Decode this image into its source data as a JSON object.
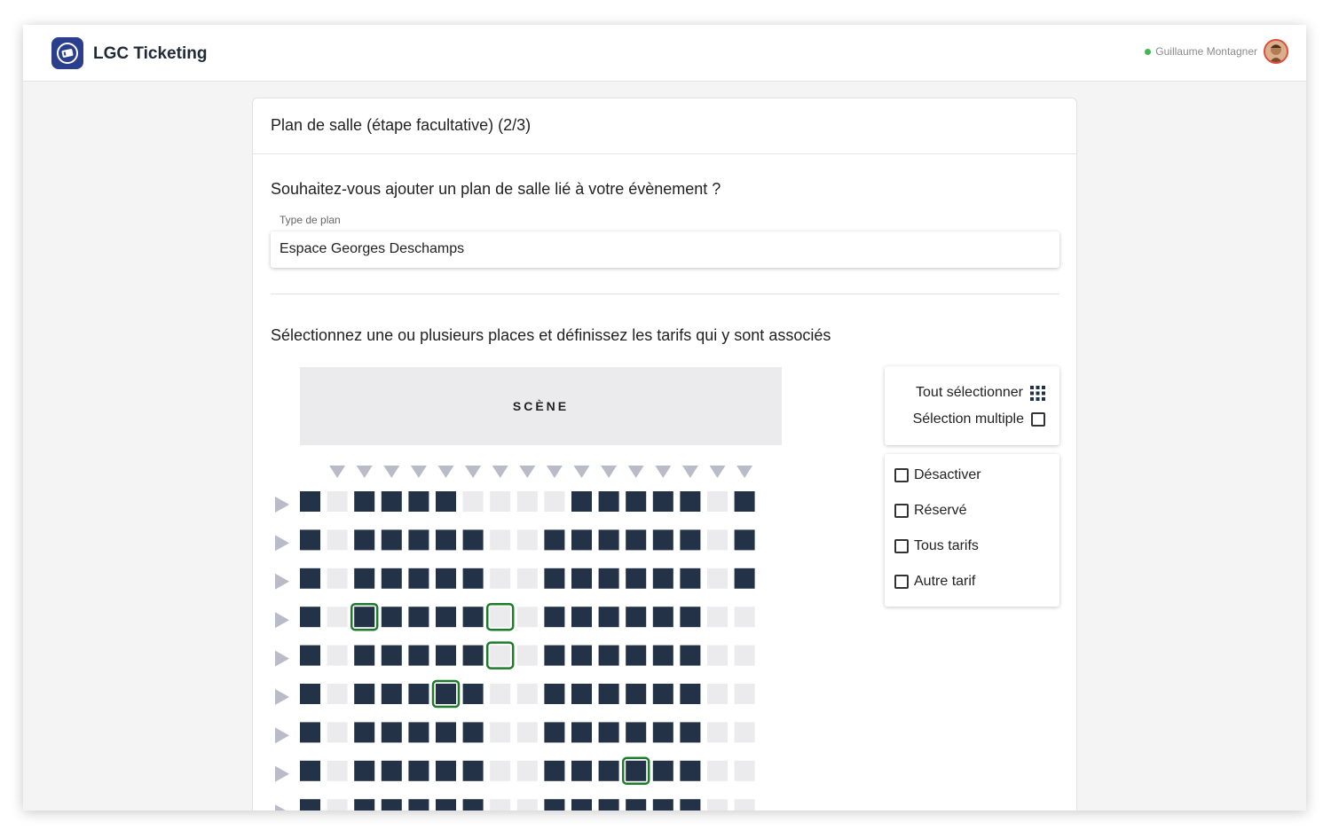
{
  "app": {
    "title": "LGC Ticketing"
  },
  "user": {
    "name": "Guillaume Montagner",
    "status_color": "#3fb950"
  },
  "card": {
    "title": "Plan de salle (étape facultative) (2/3)"
  },
  "question": "Souhaitez-vous ajouter un plan de salle lié à votre évènement ?",
  "plan_type": {
    "label": "Type de plan",
    "value": "Espace Georges Deschamps"
  },
  "instruction": "Sélectionnez une ou plusieurs places et définissez les tarifs qui y sont associés",
  "stage_label": "SCÈNE",
  "selection_panel": {
    "select_all": "Tout sélectionner",
    "multi_select": "Sélection multiple"
  },
  "options": [
    {
      "label": "Désactiver",
      "checked": false
    },
    {
      "label": "Réservé",
      "checked": false
    },
    {
      "label": "Tous tarifs",
      "checked": false
    },
    {
      "label": "Autre tarif",
      "checked": false
    }
  ],
  "colors": {
    "seat_filled": "#243247",
    "seat_empty": "#ebebed",
    "seat_selected_border": "#1e7b2c",
    "arrow": "#b9bcc8",
    "brand": "#2b3f8f"
  },
  "seat_grid": {
    "legend": "F = available seat, E = empty slot; selected seats listed by [row, column]",
    "columns": 18,
    "rows": [
      "FEFFFFEEEEFFFFFEF",
      "FEFFFFFEEFFFFFFEF",
      "FEFFFFFEEFFFFFFEF",
      "FEFFFFFEEFFFFFFEE",
      "FEFFFFFEEFFFFFFEE",
      "FEFFFFFEEFFFFFFEE",
      "FEFFFFFEEFFFFFFEE",
      "FEFFFFFEEFFFFFFEE",
      "FEFFFFFEEFFFFFFEE"
    ],
    "selected": [
      [
        3,
        2
      ],
      [
        3,
        7
      ],
      [
        4,
        7
      ],
      [
        5,
        5
      ],
      [
        7,
        12
      ]
    ]
  }
}
